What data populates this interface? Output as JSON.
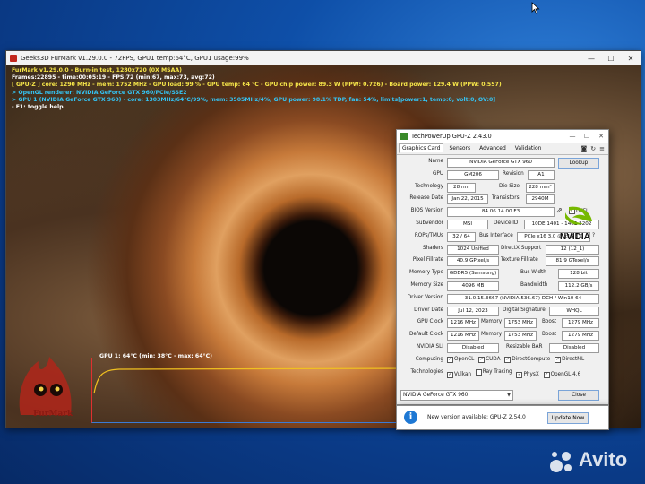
{
  "furmark": {
    "title": "Geeks3D FurMark v1.29.0.0 - 72FPS, GPU1 temp:64°C, GPU1 usage:99%",
    "overlay": {
      "line1": "FurMark v1.29.0.0 - Burn-in test, 1280x720 (0X MSAA)",
      "line2": "Frames:22895 - time:00:05:19 - FPS:72 (min:67, max:73, avg:72)",
      "line3": "[ GPU-Z ] core: 1290 MHz - mem: 1752 MHz - GPU load: 99 % - GPU temp: 64 °C - GPU chip power: 89.3 W (PPW: 0.726) - Board power: 129.4 W (PPW: 0.557)",
      "line4": "> OpenGL renderer: NVIDIA GeForce GTX 960/PCIe/SSE2",
      "line5": "> GPU 1 (NVIDIA GeForce GTX 960) - core: 1303MHz/64°C/99%, mem: 3505MHz/4%, GPU power: 98.1% TDP, fan: 54%, limits[power:1, temp:0, volt:0, OV:0]",
      "line6": "- F1: toggle help"
    },
    "graph_label": "GPU 1: 64°C (min: 38°C - max: 64°C)",
    "logo_text": "FurMark"
  },
  "gpuz": {
    "title": "TechPowerUp GPU-Z 2.43.0",
    "tabs": [
      "Graphics Card",
      "Sensors",
      "Advanced",
      "Validation"
    ],
    "name_label": "Name",
    "name": "NVIDIA GeForce GTX 960",
    "lookup": "Lookup",
    "gpu_label": "GPU",
    "gpu": "GM206",
    "revision_label": "Revision",
    "revision": "A1",
    "technology_label": "Technology",
    "technology": "28 nm",
    "die_size_label": "Die Size",
    "die_size": "228 mm²",
    "release_label": "Release Date",
    "release": "Jan 22, 2015",
    "transistors_label": "Transistors",
    "transistors": "2940M",
    "bios_label": "BIOS Version",
    "bios": "84.06.14.00.F3",
    "uefi": "UEFI",
    "subvendor_label": "Subvendor",
    "subvendor": "MSI",
    "device_id_label": "Device ID",
    "device_id": "10DE 1401 - 1462 3202",
    "rops_label": "ROPs/TMUs",
    "rops": "32 / 64",
    "bus_label": "Bus Interface",
    "bus": "PCIe x16 3.0 @ x16 3.0",
    "shaders_label": "Shaders",
    "shaders": "1024 Unified",
    "dx_label": "DirectX Support",
    "dx": "12 (12_1)",
    "pixel_label": "Pixel Fillrate",
    "pixel": "40.9 GPixel/s",
    "texture_label": "Texture Fillrate",
    "texture": "81.9 GTexel/s",
    "memtype_label": "Memory Type",
    "memtype": "GDDR5 (Samsung)",
    "buswidth_label": "Bus Width",
    "buswidth": "128 bit",
    "memsize_label": "Memory Size",
    "memsize": "4096 MB",
    "bandwidth_label": "Bandwidth",
    "bandwidth": "112.2 GB/s",
    "driver_label": "Driver Version",
    "driver": "31.0.15.3667 (NVIDIA 536.67) DCH / Win10 64",
    "driver_date_label": "Driver Date",
    "driver_date": "Jul 12, 2023",
    "sig_label": "Digital Signature",
    "sig": "WHQL",
    "gpu_clock_label": "GPU Clock",
    "gpu_clock": "1216 MHz",
    "memory_label": "Memory",
    "mem_clock": "1753 MHz",
    "boost_label": "Boost",
    "boost": "1279 MHz",
    "def_clock_label": "Default Clock",
    "def_clock": "1216 MHz",
    "def_mem": "1753 MHz",
    "def_boost": "1279 MHz",
    "sli_label": "NVIDIA SLI",
    "sli": "Disabled",
    "rebar_label": "Resizable BAR",
    "rebar": "Disabled",
    "computing_label": "Computing",
    "computing": [
      "OpenCL",
      "CUDA",
      "DirectCompute",
      "DirectML"
    ],
    "technologies_label": "Technologies",
    "technologies": [
      "Vulkan",
      "Ray Tracing",
      "PhysX",
      "OpenGL 4.6"
    ],
    "selected_gpu": "NVIDIA GeForce GTX 960",
    "close": "Close",
    "vendor_logo": "NVIDIA"
  },
  "notification": {
    "text": "New version available: GPU-Z 2.54.0",
    "button": "Update Now"
  },
  "watermark": "Avito"
}
